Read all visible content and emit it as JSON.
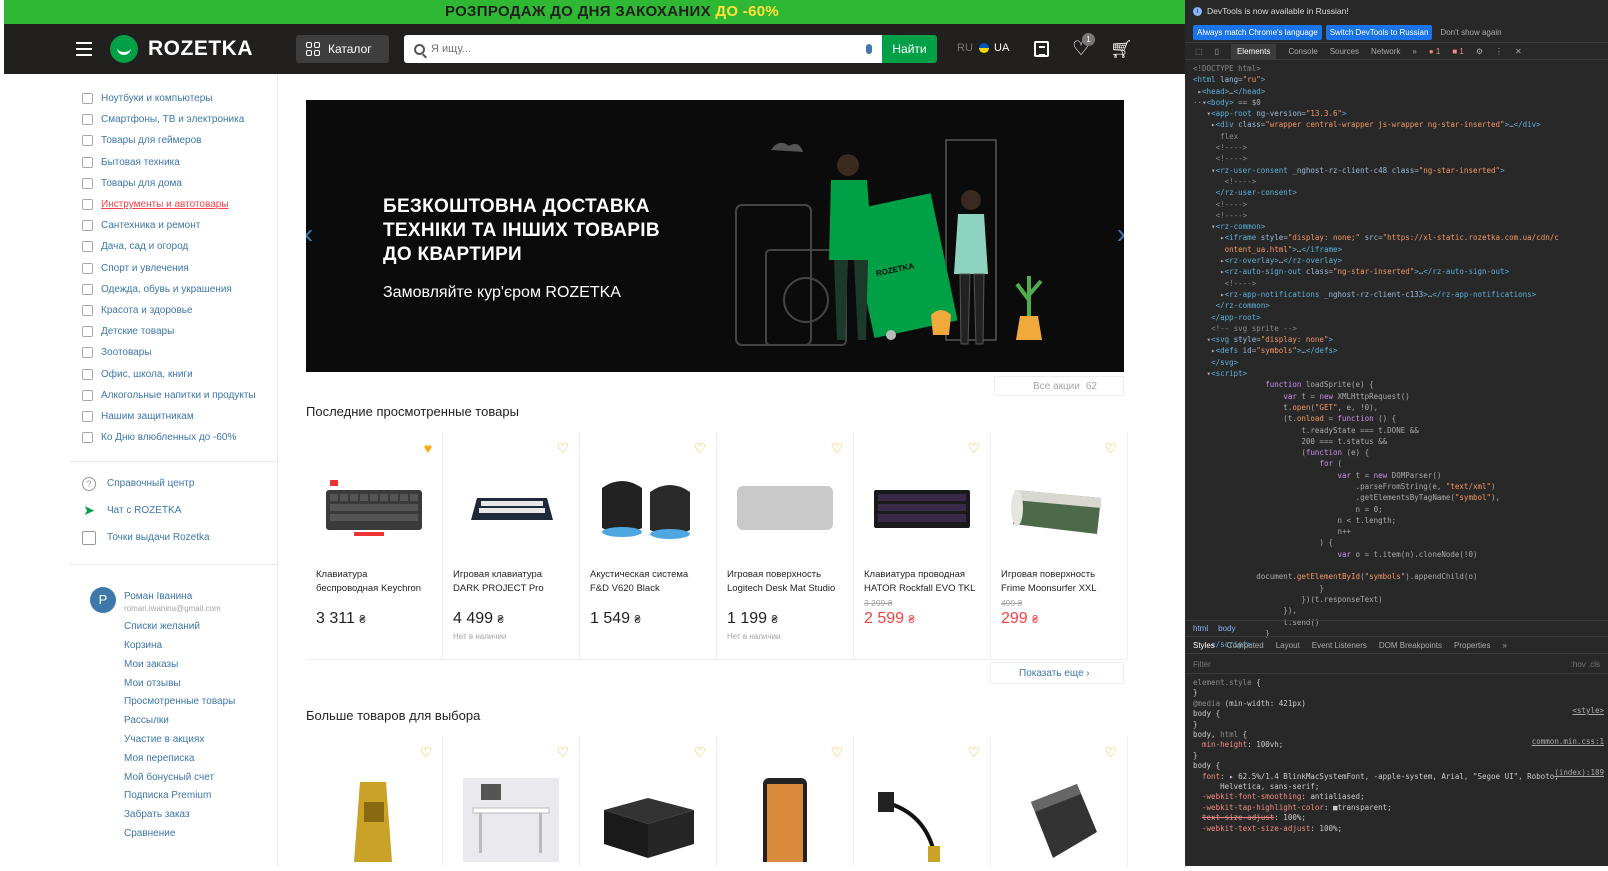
{
  "promo": {
    "text": "РОЗПРОДАЖ ДО ДНЯ ЗАКОХАНИХ",
    "highlight": "ДО -60%"
  },
  "header": {
    "logo": "ROZETKA",
    "catalog_label": "Каталог",
    "search_placeholder": "Я ищу...",
    "search_button": "Найти",
    "lang_ru": "RU",
    "lang_ua": "UA",
    "favorites_count": "1"
  },
  "sidebar": {
    "categories": [
      "Ноутбуки и компьютеры",
      "Смартфоны, ТВ и электроника",
      "Товары для геймеров",
      "Бытовая техника",
      "Товары для дома",
      "Инструменты и автотовары",
      "Сантехника и ремонт",
      "Дача, сад и огород",
      "Спорт и увлечения",
      "Одежда, обувь и украшения",
      "Красота и здоровье",
      "Детские товары",
      "Зоотовары",
      "Офис, школа, книги",
      "Алкогольные напитки и продукты",
      "Нашим защитникам",
      "Ко Дню влюбленных до -60%"
    ],
    "services": [
      "Справочный центр",
      "Чат с ROZETKA",
      "Точки выдачи Rozetka"
    ],
    "user": {
      "initial": "P",
      "name": "Роман Іванина",
      "email": "roman.iwanina@gmail.com",
      "links": [
        "Списки желаний",
        "Корзина",
        "Мои заказы",
        "Мои отзывы",
        "Просмотренные товары",
        "Рассылки",
        "Участие в акциях",
        "Моя переписка",
        "Мой бонусный счет",
        "Подписка Premium",
        "Забрать заказ",
        "Сравнение"
      ]
    }
  },
  "banner": {
    "headline_1": "БЕЗКОШТОВНА ДОСТАВКА",
    "headline_2": "ТЕХНІКИ ТА ІНШИХ ТОВАРІВ",
    "headline_3": "ДО КВАРТИРИ",
    "sub": "Замовляйте кур'єром ROZETKA",
    "box_label": "ROZETKA"
  },
  "all_promos": {
    "label": "Все акции",
    "count": "62"
  },
  "recent": {
    "title": "Последние просмотренные товары",
    "show_more": "Показать еще",
    "products": [
      {
        "name_1": "Клавиатура",
        "name_2": "беспроводная Keychron",
        "old": "",
        "price": "3 311",
        "sale": false,
        "stock": ""
      },
      {
        "name_1": "Игровая клавиатура",
        "name_2": "DARK PROJECT Pro",
        "old": "",
        "price": "4 499",
        "sale": false,
        "stock": "Нет в наличии"
      },
      {
        "name_1": "Акустическая система",
        "name_2": "F&D V620 Black",
        "old": "",
        "price": "1 549",
        "sale": false,
        "stock": ""
      },
      {
        "name_1": "Игровая поверхность",
        "name_2": "Logitech Desk Mat Studio",
        "old": "",
        "price": "1 199",
        "sale": false,
        "stock": "Нет в наличии"
      },
      {
        "name_1": "Клавиатура проводная",
        "name_2": "HATOR Rockfall EVO TKL",
        "old": "3 299 ₴",
        "price": "2 599",
        "sale": true,
        "stock": ""
      },
      {
        "name_1": "Игровая поверхность",
        "name_2": "Frime Moonsurfer XXL",
        "old": "499 ₴",
        "price": "299",
        "sale": true,
        "stock": ""
      }
    ],
    "currency": "₴"
  },
  "more": {
    "title": "Больше товаров для выбора"
  },
  "devtools": {
    "info": "DevTools is now available in Russian!",
    "btn_match": "Always match Chrome's language",
    "btn_switch": "Switch DevTools to Russian",
    "btn_dont": "Don't show again",
    "tabs": [
      "Elements",
      "Console",
      "Sources",
      "Network"
    ],
    "errors_1": "1",
    "errors_2": "1",
    "crumb_html": "html",
    "crumb_body": "body",
    "style_tabs": [
      "Styles",
      "Computed",
      "Layout",
      "Event Listeners",
      "DOM Breakpoints",
      "Properties"
    ],
    "filter": "Filter",
    "filter_right": ":hov .cls",
    "link_style": "<style>",
    "link_common": "common.min.css:1",
    "link_index": "(index):189"
  },
  "colors": {
    "brand_green": "#00a046",
    "link": "#3e77aa",
    "sale": "#f84147",
    "heart": "#ffa900",
    "header": "#221f1f"
  }
}
